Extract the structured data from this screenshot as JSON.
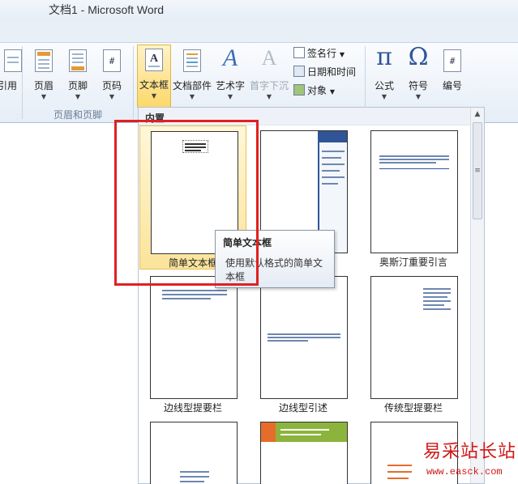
{
  "window": {
    "title": "文档1 - Microsoft Word"
  },
  "ribbon": {
    "partial_button": "引用",
    "header_footer_group": {
      "label": "页眉和页脚",
      "buttons": [
        "页眉",
        "页脚",
        "页码"
      ]
    },
    "text_group": {
      "buttons": [
        "文本框",
        "文档部件",
        "艺术字",
        "首字下沉"
      ],
      "small_buttons": [
        "签名行",
        "日期和时间",
        "对象"
      ]
    },
    "symbol_group": {
      "buttons": [
        "公式",
        "符号",
        "编号"
      ],
      "glyphs": {
        "equation": "π",
        "symbol": "Ω",
        "number": "#"
      }
    }
  },
  "gallery": {
    "section_title": "内置",
    "items": [
      {
        "label": "简单文本框"
      },
      {
        "label": ""
      },
      {
        "label": "奥斯汀重要引言"
      },
      {
        "label": "边线型提要栏"
      },
      {
        "label": "边线型引述"
      },
      {
        "label": "传统型提要栏"
      }
    ]
  },
  "tooltip": {
    "title": "简单文本框",
    "body": "使用默认格式的简单文本框"
  },
  "watermark": {
    "title": "易采站长站",
    "url": "www.easck.com"
  },
  "colors": {
    "highlight": "#e02020",
    "selected_tile": "#fbe39a",
    "accent": "#2f5597"
  }
}
